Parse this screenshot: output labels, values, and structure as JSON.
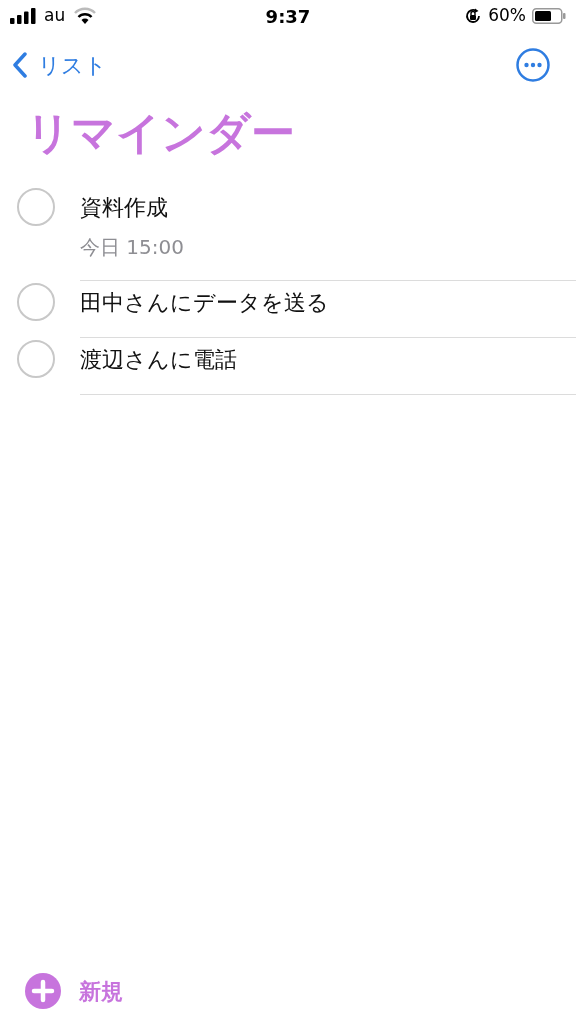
{
  "status_bar": {
    "carrier": "au",
    "time": "9:37",
    "battery": "60%"
  },
  "nav": {
    "back_label": "リスト"
  },
  "title": "リマインダー",
  "reminders": [
    {
      "title": "資料作成",
      "due": "今日 15:00",
      "checked": false
    },
    {
      "title": "田中さんにデータを送る",
      "checked": false
    },
    {
      "title": "渡辺さんに電話",
      "checked": false
    }
  ],
  "new_button": {
    "label": "新規"
  }
}
